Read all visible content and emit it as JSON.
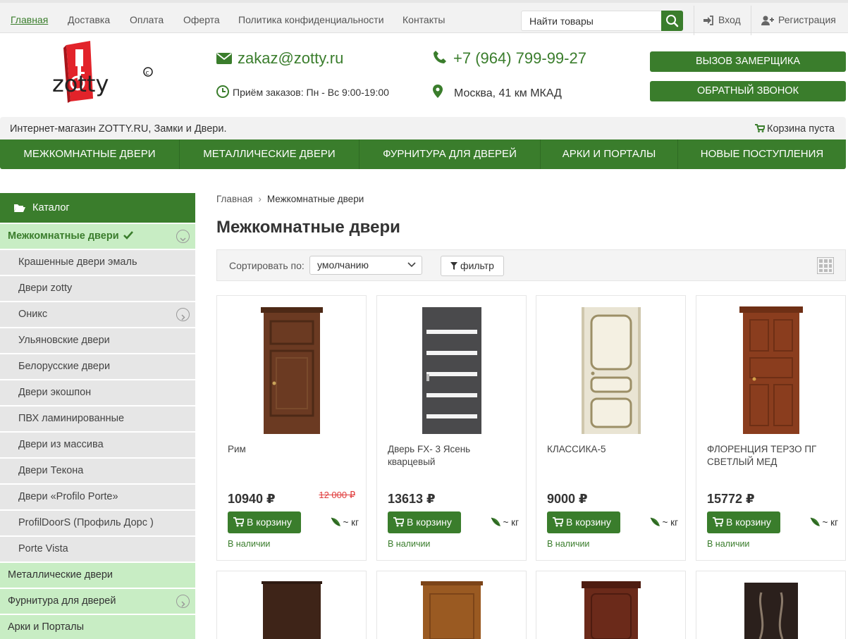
{
  "top_nav": [
    "Главная",
    "Доставка",
    "Оплата",
    "Оферта",
    "Политика конфиденциальности",
    "Контакты"
  ],
  "search": {
    "placeholder": "Найти товары"
  },
  "auth": {
    "login": "Вход",
    "register": "Регистрация"
  },
  "header": {
    "logo_text": "zotty",
    "email": "zakaz@zotty.ru",
    "phone": "+7 (964) 799-99-27",
    "hours": "Приём заказов: Пн - Вс 9:00-19:00",
    "address": "Москва, 41 км МКАД",
    "btn_measurer": "Вызов замерщика",
    "btn_callback": "Обратный звонок"
  },
  "infobar": {
    "text": "Интернет-магазин ZOTTY.RU, Замки и Двери.",
    "cart": "Корзина пуста"
  },
  "main_nav": [
    "Межкомнатные двери",
    "Металлические двери",
    "Фурнитура для дверей",
    "Арки и порталы",
    "Новые поступления"
  ],
  "sidebar": {
    "title": "Каталог",
    "items": [
      {
        "label": "Межкомнатные двери",
        "type": "active"
      },
      {
        "label": "Крашенные двери эмаль",
        "type": "sub"
      },
      {
        "label": "Двери zotty",
        "type": "sub"
      },
      {
        "label": "Оникс",
        "type": "sub"
      },
      {
        "label": "Ульяновские двери",
        "type": "sub"
      },
      {
        "label": "Белорусские двери",
        "type": "sub"
      },
      {
        "label": "Двери экошпон",
        "type": "sub"
      },
      {
        "label": "ПВХ ламинированные",
        "type": "sub"
      },
      {
        "label": "Двери из массива",
        "type": "sub"
      },
      {
        "label": "Двери Текона",
        "type": "sub"
      },
      {
        "label": "Двери «Profilo Porte»",
        "type": "sub"
      },
      {
        "label": "ProfilDoorS (Профиль Дорс )",
        "type": "sub"
      },
      {
        "label": "Porte Vista",
        "type": "sub"
      },
      {
        "label": "Металлические двери",
        "type": "top"
      },
      {
        "label": "Фурнитура для дверей",
        "type": "top"
      },
      {
        "label": "Арки и Порталы",
        "type": "top"
      }
    ]
  },
  "breadcrumb": {
    "home": "Главная",
    "sep": "›",
    "current": "Межкомнатные двери"
  },
  "page_title": "Межкомнатные двери",
  "sort": {
    "label": "Сортировать по:",
    "value": "умолчанию",
    "filter": "фильтр"
  },
  "products": [
    {
      "name": "Рим",
      "price": "10940 ₽",
      "old_price": "12 000 ₽",
      "buy": "В корзину",
      "weight": "~ кг",
      "stock": "В наличии",
      "color": "#6b3a22",
      "style": "classic"
    },
    {
      "name": "Дверь FX- 3 Ясень кварцевый",
      "price": "13613 ₽",
      "old_price": "",
      "buy": "В корзину",
      "weight": "~ кг",
      "stock": "В наличии",
      "color": "#4a4a4c",
      "style": "glass"
    },
    {
      "name": "КЛАССИКА-5",
      "price": "9000 ₽",
      "old_price": "",
      "buy": "В корзину",
      "weight": "~ кг",
      "stock": "В наличии",
      "color": "#e9e4d3",
      "style": "light"
    },
    {
      "name": "ФЛОРЕНЦИЯ ТЕРЗО ПГ СВЕТЛЫЙ МЕД",
      "price": "15772 ₽",
      "old_price": "",
      "buy": "В корзину",
      "weight": "~ кг",
      "stock": "В наличии",
      "color": "#8a3d1e",
      "style": "panels"
    }
  ],
  "colors": {
    "accent": "#3a7d2c",
    "sidebar_light": "#c8edc4",
    "sale": "#e03a3a"
  }
}
